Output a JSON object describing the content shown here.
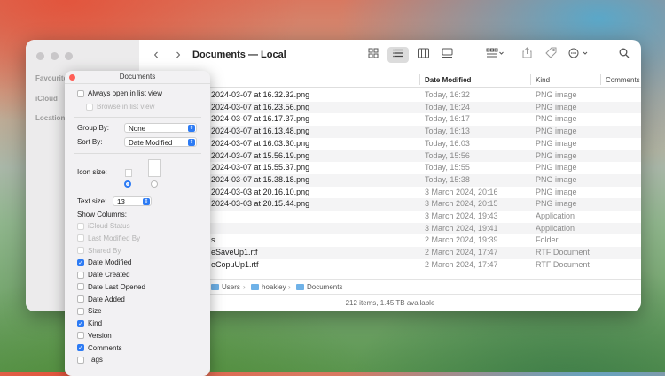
{
  "window": {
    "title": "Documents — Local",
    "sidebar": {
      "sections": [
        "Favourites",
        "iCloud",
        "Locations"
      ]
    },
    "toolbar": {
      "back_icon": "chevron-left-icon",
      "forward_icon": "chevron-right-icon",
      "view_icons": [
        "icon-view-icon",
        "list-view-icon",
        "column-view-icon",
        "gallery-view-icon"
      ],
      "selected_view": "list-view-icon",
      "group_icon": "group-icon",
      "share_icon": "share-icon",
      "tag_icon": "tag-icon",
      "more_icon": "more-icon",
      "search_icon": "search-icon"
    },
    "columns": {
      "date": "Date Modified",
      "kind": "Kind",
      "comments": "Comments"
    },
    "rows": [
      {
        "name": "2024-03-07 at 16.32.32.png",
        "date": "Today, 16:32",
        "kind": "PNG image"
      },
      {
        "name": "2024-03-07 at 16.23.56.png",
        "date": "Today, 16:24",
        "kind": "PNG image"
      },
      {
        "name": "2024-03-07 at 16.17.37.png",
        "date": "Today, 16:17",
        "kind": "PNG image"
      },
      {
        "name": "2024-03-07 at 16.13.48.png",
        "date": "Today, 16:13",
        "kind": "PNG image"
      },
      {
        "name": "2024-03-07 at 16.03.30.png",
        "date": "Today, 16:03",
        "kind": "PNG image"
      },
      {
        "name": "2024-03-07 at 15.56.19.png",
        "date": "Today, 15:56",
        "kind": "PNG image"
      },
      {
        "name": "2024-03-07 at 15.55.37.png",
        "date": "Today, 15:55",
        "kind": "PNG image"
      },
      {
        "name": "2024-03-07 at 15.38.18.png",
        "date": "Today, 15:38",
        "kind": "PNG image"
      },
      {
        "name": "2024-03-03 at 20.16.10.png",
        "date": "3 March 2024, 20:16",
        "kind": "PNG image"
      },
      {
        "name": "2024-03-03 at 20.15.44.png",
        "date": "3 March 2024, 20:15",
        "kind": "PNG image"
      },
      {
        "name": "",
        "date": "3 March 2024, 19:43",
        "kind": "Application"
      },
      {
        "name": "",
        "date": "3 March 2024, 19:41",
        "kind": "Application"
      },
      {
        "name": "s",
        "date": "2 March 2024, 19:39",
        "kind": "Folder"
      },
      {
        "name": "eSaveUp1.rtf",
        "date": "2 March 2024, 17:47",
        "kind": "RTF Document"
      },
      {
        "name": "eCopuUp1.rtf",
        "date": "2 March 2024, 17:47",
        "kind": "RTF Document"
      }
    ],
    "path": [
      "Users",
      "hoakley",
      "Documents"
    ],
    "status": "212 items, 1.45 TB available"
  },
  "view_options": {
    "title": "Documents",
    "always_open_list": "Always open in list view",
    "browse_list": "Browse in list view",
    "group_by_label": "Group By:",
    "group_by_value": "None",
    "sort_by_label": "Sort By:",
    "sort_by_value": "Date Modified",
    "icon_size_label": "Icon size:",
    "text_size_label": "Text size:",
    "text_size_value": "13",
    "show_columns_label": "Show Columns:",
    "columns": [
      {
        "label": "iCloud Status",
        "checked": false,
        "disabled": true
      },
      {
        "label": "Last Modified By",
        "checked": false,
        "disabled": true
      },
      {
        "label": "Shared By",
        "checked": false,
        "disabled": true
      },
      {
        "label": "Date Modified",
        "checked": true,
        "disabled": false
      },
      {
        "label": "Date Created",
        "checked": false,
        "disabled": false
      },
      {
        "label": "Date Last Opened",
        "checked": false,
        "disabled": false
      },
      {
        "label": "Date Added",
        "checked": false,
        "disabled": false
      },
      {
        "label": "Size",
        "checked": false,
        "disabled": false
      },
      {
        "label": "Kind",
        "checked": true,
        "disabled": false
      },
      {
        "label": "Version",
        "checked": false,
        "disabled": false
      },
      {
        "label": "Comments",
        "checked": true,
        "disabled": false
      },
      {
        "label": "Tags",
        "checked": false,
        "disabled": false
      }
    ]
  },
  "colors": {
    "accent": "#2d7bf4",
    "folder": "#6fb2e8",
    "close": "#ff5f57"
  }
}
